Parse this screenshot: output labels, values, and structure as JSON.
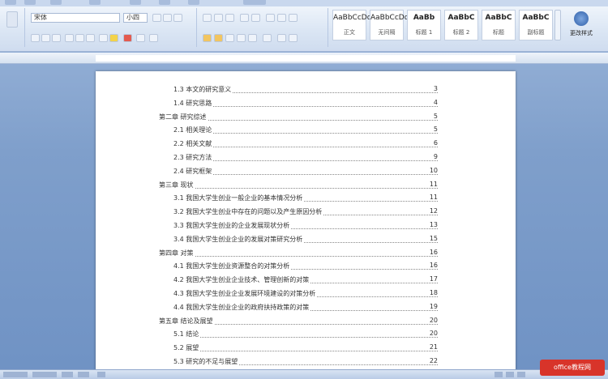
{
  "ribbon": {
    "font_name": "宋体",
    "font_size": "小四",
    "styles": [
      {
        "sample": "AaBbCcDd",
        "label": "正文"
      },
      {
        "sample": "AaBbCcDd",
        "label": "无间隔"
      },
      {
        "sample": "AaBb",
        "label": "标题 1"
      },
      {
        "sample": "AaBbC",
        "label": "标题 2"
      },
      {
        "sample": "AaBbC",
        "label": "标题"
      },
      {
        "sample": "AaBbC",
        "label": "副标题"
      }
    ],
    "change_styles_label": "更改样式"
  },
  "toc": [
    {
      "text": "1.3 本文的研究意义",
      "page": "3",
      "level": 2
    },
    {
      "text": "1.4 研究思路",
      "page": "4",
      "level": 2
    },
    {
      "text": "第二章 研究综述",
      "page": "5",
      "level": 1
    },
    {
      "text": "2.1 相关理论",
      "page": "5",
      "level": 2
    },
    {
      "text": "2.2 相关文献",
      "page": "6",
      "level": 2
    },
    {
      "text": "2.3 研究方法",
      "page": "9",
      "level": 2
    },
    {
      "text": "2.4 研究框架",
      "page": "10",
      "level": 2
    },
    {
      "text": "第三章 现状",
      "page": "11",
      "level": 1
    },
    {
      "text": "3.1 我国大学生创业一般企业的基本情况分析",
      "page": "11",
      "level": 2
    },
    {
      "text": "3.2 我国大学生创业中存在的问题以及产生原因分析",
      "page": "12",
      "level": 2
    },
    {
      "text": "3.3 我国大学生创业的企业发展现状分析",
      "page": "13",
      "level": 2
    },
    {
      "text": "3.4 我国大学生创业企业的发展对策研究分析",
      "page": "15",
      "level": 2
    },
    {
      "text": "第四章 对策",
      "page": "16",
      "level": 1
    },
    {
      "text": "4.1 我国大学生创业资源整合的对策分析",
      "page": "16",
      "level": 2
    },
    {
      "text": "4.2 我国大学生创业企业技术、管理创新的对策",
      "page": "17",
      "level": 2
    },
    {
      "text": "4.3 我国大学生创业企业发展环境建设的对策分析",
      "page": "18",
      "level": 2
    },
    {
      "text": "4.4 我国大学生创业企业的政府扶持政策的对策",
      "page": "19",
      "level": 2
    },
    {
      "text": "第五章 结论及展望",
      "page": "20",
      "level": 1
    },
    {
      "text": "5.1 结论",
      "page": "20",
      "level": 2
    },
    {
      "text": "5.2 展望",
      "page": "21",
      "level": 2
    },
    {
      "text": "5.3 研究的不足与展望",
      "page": "22",
      "level": 2
    }
  ],
  "watermark_logo": "office教程网"
}
